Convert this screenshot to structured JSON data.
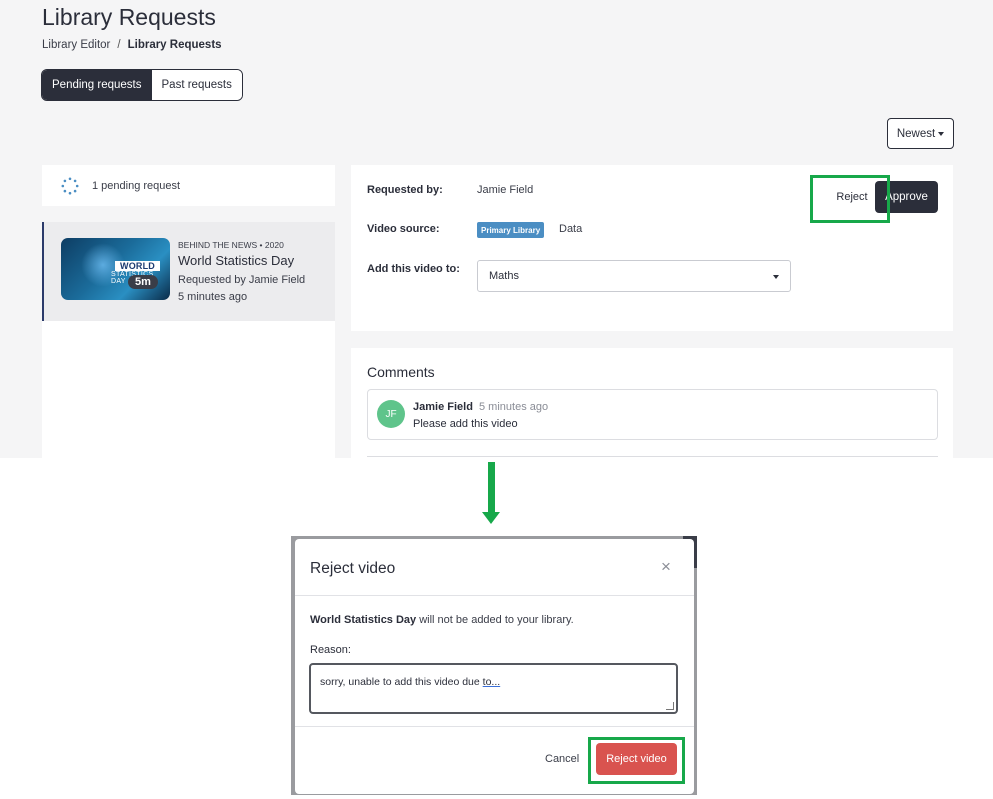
{
  "page": {
    "title": "Library Requests",
    "breadcrumb": {
      "parent": "Library Editor",
      "separator": "/",
      "current": "Library Requests"
    }
  },
  "tabs": [
    {
      "label": "Pending requests",
      "active": true
    },
    {
      "label": "Past requests",
      "active": false
    }
  ],
  "sort": {
    "label": "Newest"
  },
  "pending": {
    "count_text": "1 pending request"
  },
  "video_item": {
    "series": "BEHIND THE NEWS • 2020",
    "title": "World Statistics Day",
    "requested_by": "Requested by Jamie Field",
    "time": "5 minutes ago",
    "thumb_label": "WORLD",
    "thumb_sub": "STATISTICS DAY",
    "duration": "5m"
  },
  "detail": {
    "requested_by_label": "Requested by:",
    "requested_by_value": "Jamie Field",
    "video_source_label": "Video source:",
    "source_badge": "Primary Library",
    "source_value": "Data",
    "add_to_label": "Add this video to:",
    "add_to_value": "Maths",
    "reject_label": "Reject",
    "approve_label": "Approve"
  },
  "comments": {
    "heading": "Comments",
    "items": [
      {
        "initials": "JF",
        "name": "Jamie Field",
        "time": "5 minutes ago",
        "text": "Please add this video"
      }
    ]
  },
  "modal": {
    "title": "Reject video",
    "close_glyph": "×",
    "message_bold": "World Statistics Day",
    "message_rest": " will not be added to your library.",
    "reason_label": "Reason:",
    "reason_text_a": "sorry, unable to add this video due ",
    "reason_text_b": "to...",
    "cancel_label": "Cancel",
    "confirm_label": "Reject video"
  },
  "colors": {
    "highlight": "#17a84a",
    "dark": "#2b2e3a",
    "danger": "#d9534f",
    "badge": "#4b8ec3",
    "avatar": "#5fc48b"
  }
}
